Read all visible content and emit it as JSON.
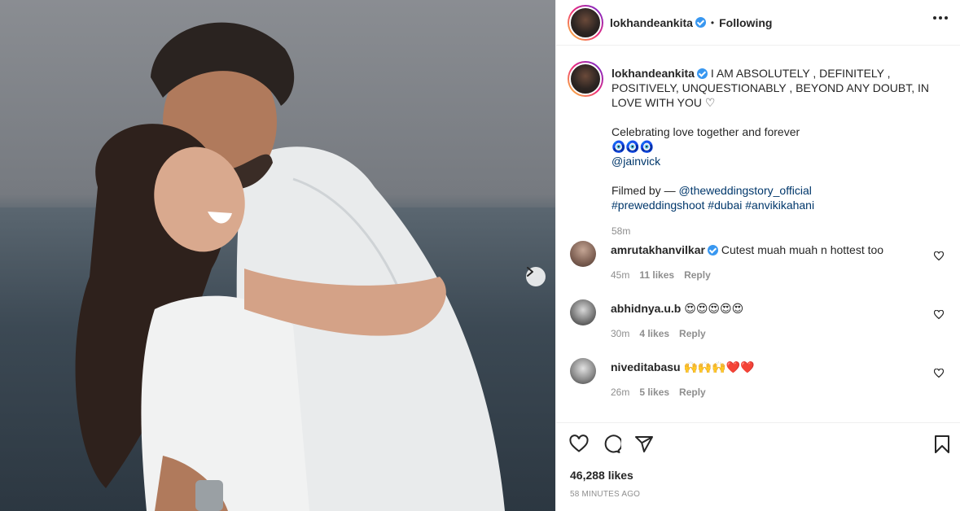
{
  "post": {
    "username": "lokhandeankita",
    "follow_status": "Following",
    "separator": "•",
    "caption_line1": "I AM ABSOLUTELY , DEFINITELY , POSITIVELY, UNQUESTIONABLY , BEYOND ANY DOUBT, IN LOVE WITH YOU ♡",
    "caption_line2": "Celebrating love together and forever",
    "caption_emojis": "🧿🧿🧿",
    "mention1": "@jainvick",
    "filmed_by": "Filmed by — ",
    "mention2": "@theweddingstory_official",
    "hashtags": "#preweddingshoot #dubai #anvikikahani",
    "caption_time": "58m",
    "likes": "46,288 likes",
    "time_ago": "58 MINUTES AGO"
  },
  "comments": [
    {
      "username": "amrutakhanvilkar",
      "verified": true,
      "text": "Cutest muah muah n hottest too",
      "time": "45m",
      "likes": "11 likes",
      "reply": "Reply"
    },
    {
      "username": "abhidnya.u.b",
      "verified": false,
      "text": "😍😍😍😍😍",
      "time": "30m",
      "likes": "4 likes",
      "reply": "Reply"
    },
    {
      "username": "niveditabasu",
      "verified": false,
      "text": "🙌🙌🙌❤️❤️",
      "time": "26m",
      "likes": "5 likes",
      "reply": "Reply"
    }
  ],
  "colors": {
    "link": "#00376b",
    "verified": "#3897f0",
    "muted": "#8e8e8e",
    "text": "#262626"
  }
}
